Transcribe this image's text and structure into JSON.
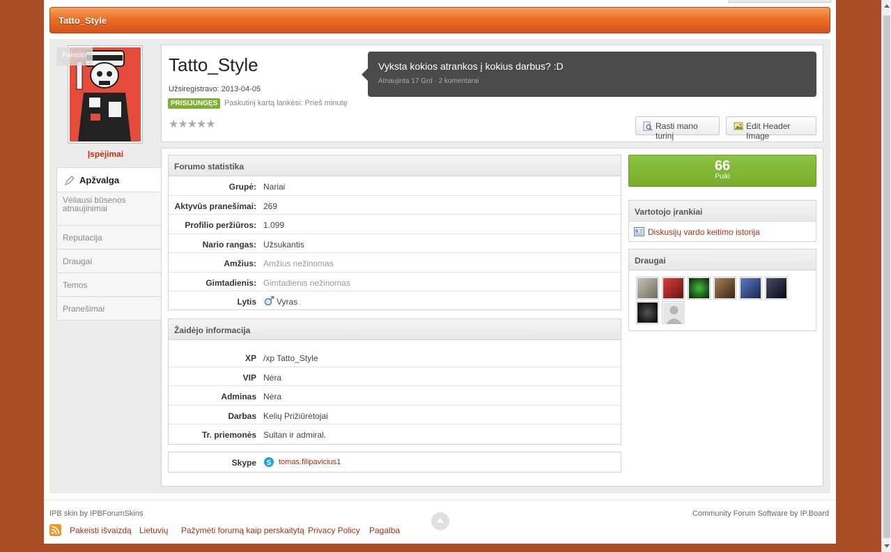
{
  "header": {
    "title": "Tatto_Style"
  },
  "profile": {
    "change_photo": "Pakeisti",
    "warnings": "Įspėjimai",
    "username": "Tatto_Style",
    "joined": "Užsiregistravo: 2013-04-05",
    "online_badge": "PRISIJUNGĘS",
    "last_visit": "Paskutinį kartą lankėsi: Prieš minutę",
    "stars": "★★★★★",
    "status": {
      "text": "Vyksta kokios atrankos į kokius darbus? :D",
      "meta": "Atnaujinta 17 Grd · 2 komentarai"
    },
    "buttons": {
      "find_content": "Rasti mano turinį",
      "edit_header": "Edit Header Image"
    }
  },
  "nav": {
    "items": [
      {
        "label": "Apžvalga"
      },
      {
        "label": "Vėliausi būsenos atnaujinimai"
      },
      {
        "label": "Reputacija"
      },
      {
        "label": "Draugai"
      },
      {
        "label": "Temos"
      },
      {
        "label": "Pranešimai"
      }
    ]
  },
  "stats": {
    "title": "Forumo statistika",
    "rows": [
      {
        "label": "Grupė:",
        "value": "Nariai"
      },
      {
        "label": "Aktyvūs pranešimai:",
        "value": "269"
      },
      {
        "label": "Profilio peržiūros:",
        "value": "1.099"
      },
      {
        "label": "Nario rangas:",
        "value": "Užsukantis"
      },
      {
        "label": "Amžius:",
        "value": "Amžius nežinomas"
      },
      {
        "label": "Gimtadienis:",
        "value": "Gimtadienis nežinomas"
      },
      {
        "label": "Lytis",
        "value": "Vyras"
      }
    ]
  },
  "player": {
    "title": "Žaidėjo informacija",
    "rows": [
      {
        "label": "XP",
        "value": "/xp Tatto_Style"
      },
      {
        "label": "VIP",
        "value": "Nėra"
      },
      {
        "label": "Adminas",
        "value": "Nėra"
      },
      {
        "label": "Darbas",
        "value": "Kelių Prižiūrėtojai"
      },
      {
        "label": "Tr. priemonės",
        "value": "Sultan ir admiral."
      }
    ]
  },
  "contact": {
    "label": "Skype",
    "value": "tomas.filipavicius1"
  },
  "reputation": {
    "value": "66",
    "label": "Puiki"
  },
  "tools": {
    "title": "Vartotojo įrankiai",
    "link": "Diskusijų vardo keitimo istorija"
  },
  "friends": {
    "title": "Draugai",
    "colors": [
      "#8d8a80",
      "#b5242a",
      "#163a12",
      "#6b4a2a",
      "#2f4a8a",
      "#1a1a2a",
      "#111111",
      "#c9c9c9"
    ]
  },
  "footer": {
    "skin_credit": "IPB skin by IPBForumSkins",
    "ipb_credit": "Community Forum Software by IP.Board",
    "links": [
      "Pakeisti išvaizdą",
      "Lietuvių",
      "Pažymėti forumą kaip perskaitytą",
      "Privacy Policy",
      "Pagalba"
    ]
  }
}
